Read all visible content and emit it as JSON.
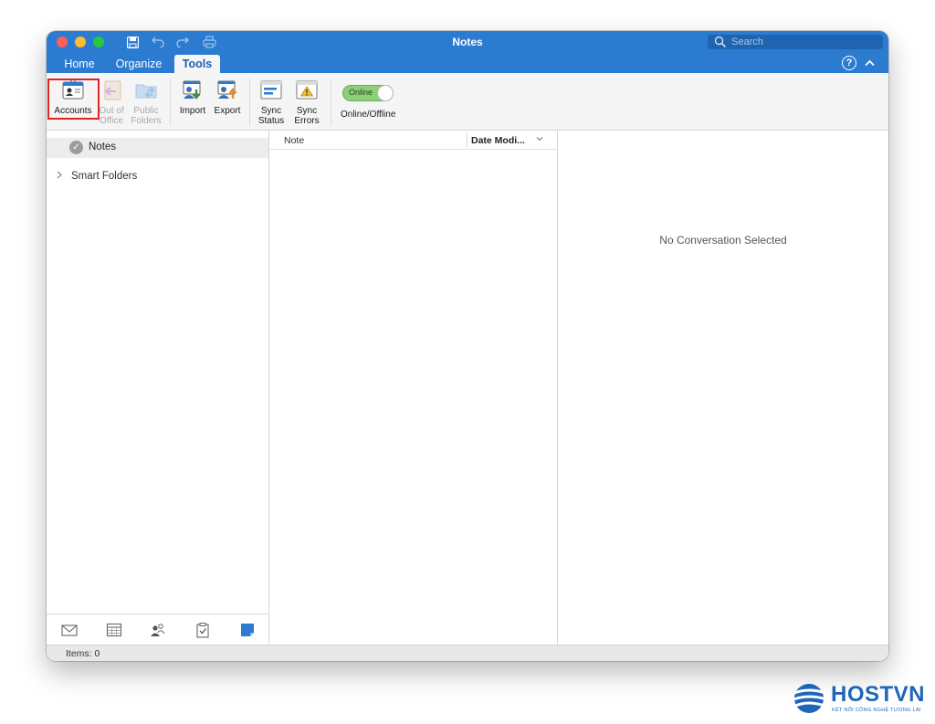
{
  "window": {
    "title": "Notes"
  },
  "quick_access": [
    {
      "icon": "save-icon"
    },
    {
      "icon": "undo-icon"
    },
    {
      "icon": "redo-icon"
    },
    {
      "icon": "print-icon"
    }
  ],
  "search": {
    "placeholder": "Search",
    "icon": "search-icon"
  },
  "tabs": [
    {
      "label": "Home"
    },
    {
      "label": "Organize"
    },
    {
      "label": "Tools",
      "active": true
    }
  ],
  "ribbon": {
    "accounts": {
      "label": "Accounts",
      "icon": "accounts-icon",
      "highlighted": true
    },
    "out_of_office": {
      "label_line1": "Out of",
      "label_line2": "Office",
      "icon": "out-of-office-icon",
      "disabled": true
    },
    "public_folders": {
      "label_line1": "Public",
      "label_line2": "Folders",
      "icon": "public-folders-icon",
      "disabled": true
    },
    "import": {
      "label": "Import",
      "icon": "import-icon"
    },
    "export": {
      "label": "Export",
      "icon": "export-icon"
    },
    "sync_status": {
      "label_line1": "Sync",
      "label_line2": "Status",
      "icon": "sync-status-icon"
    },
    "sync_errors": {
      "label_line1": "Sync",
      "label_line2": "Errors",
      "icon": "sync-errors-icon"
    },
    "online_toggle": {
      "state_text": "Online",
      "label": "Online/Offline",
      "on": true
    }
  },
  "sidebar": {
    "folders": [
      {
        "label": "Notes",
        "selected": true
      },
      {
        "label": "Smart Folders",
        "expandable": true
      }
    ],
    "nav": [
      {
        "icon": "mail-icon"
      },
      {
        "icon": "calendar-icon"
      },
      {
        "icon": "people-icon"
      },
      {
        "icon": "tasks-icon"
      },
      {
        "icon": "notes-icon",
        "active": true
      }
    ]
  },
  "list": {
    "columns": [
      {
        "label": "Note"
      },
      {
        "label": "Date Modi..."
      }
    ]
  },
  "reading_pane": {
    "empty_text": "No Conversation Selected"
  },
  "status": {
    "items_text": "Items: 0"
  },
  "watermark": {
    "brand": "HOSTVN",
    "tagline": "KẾT NỐI CÔNG NGHỆ TƯƠNG LAI"
  },
  "colors": {
    "accent": "#2b7bd1",
    "highlight_border": "#e02424",
    "toggle_on": "#8fcf78"
  }
}
